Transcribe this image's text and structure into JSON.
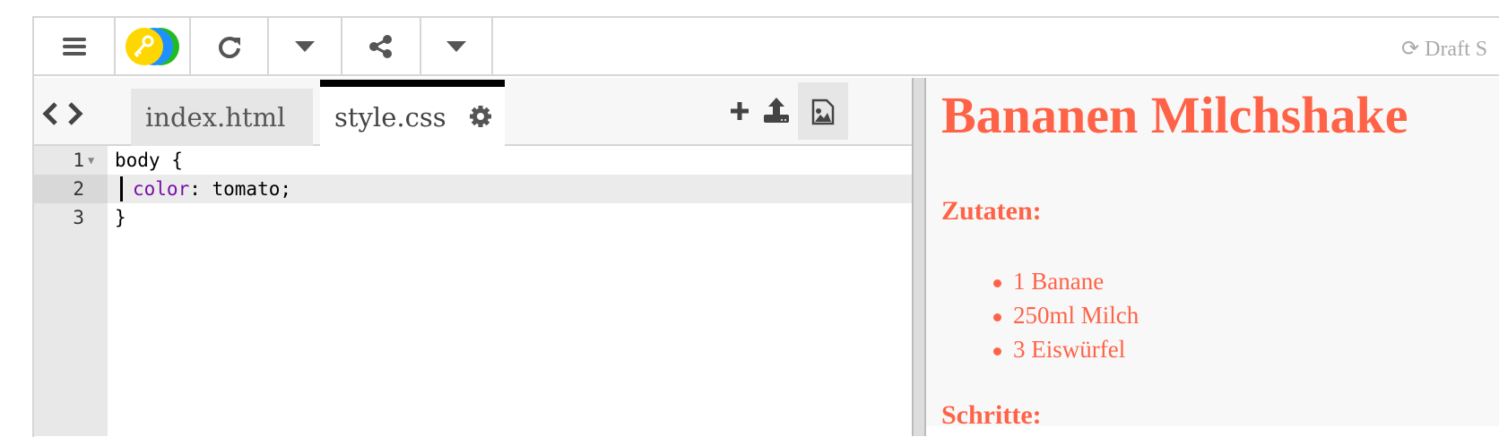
{
  "toolbar": {
    "status": "Draft S",
    "icons": [
      "menu-icon",
      "key-icon",
      "refresh-icon",
      "dropdown-icon",
      "share-icon",
      "dropdown-icon"
    ]
  },
  "editor": {
    "tabs": [
      {
        "label": "index.html",
        "active": false
      },
      {
        "label": "style.css",
        "active": true
      }
    ],
    "lines": [
      {
        "num": "1",
        "text": "body {"
      },
      {
        "num": "2",
        "prop": "color",
        "rest": ": tomato;"
      },
      {
        "num": "3",
        "text": "}"
      }
    ]
  },
  "preview": {
    "title": "Bananen Milchshake",
    "heading1": "Zutaten:",
    "ingredients": [
      "1 Banane",
      "250ml Milch",
      "3 Eiswürfel"
    ],
    "heading2": "Schritte:"
  },
  "colors": {
    "accent": "#ff6347",
    "keyword": "#7a0fa8"
  }
}
